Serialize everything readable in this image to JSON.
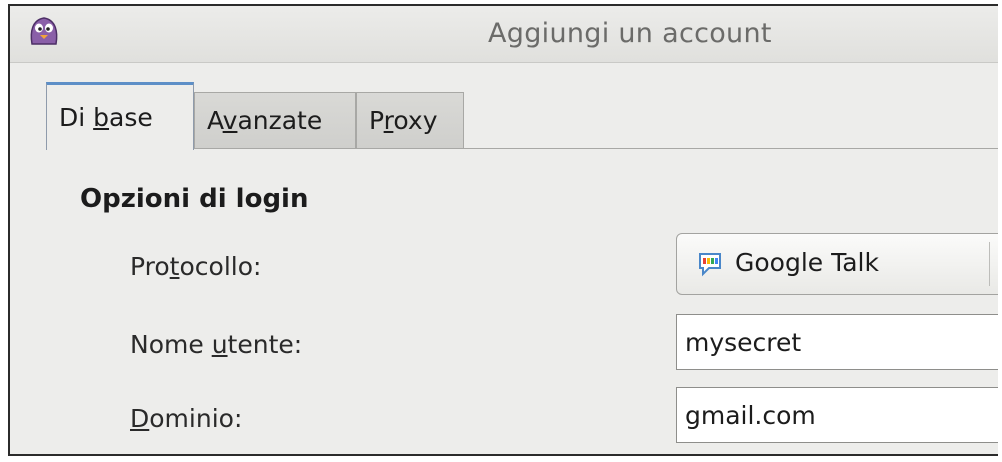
{
  "window": {
    "title": "Aggiungi un account",
    "app_icon": "pidgin-icon"
  },
  "tabs": [
    {
      "pre": "Di ",
      "mnemonic": "b",
      "post": "ase",
      "active": true
    },
    {
      "pre": "A",
      "mnemonic": "v",
      "post": "anzate",
      "active": false
    },
    {
      "pre": "P",
      "mnemonic": "r",
      "post": "oxy",
      "active": false
    }
  ],
  "section": {
    "title": "Opzioni di login"
  },
  "fields": {
    "protocol": {
      "label_pre": "Pro",
      "label_mnemonic": "t",
      "label_post": "ocollo:",
      "value": "Google Talk",
      "icon": "google-talk-icon"
    },
    "username": {
      "label_pre": "Nome ",
      "label_mnemonic": "u",
      "label_post": "tente:",
      "value": "mysecret"
    },
    "domain": {
      "label_pre": "",
      "label_mnemonic": "D",
      "label_post": "ominio:",
      "value": "gmail.com"
    }
  },
  "colors": {
    "active_tab_accent": "#5d8fc7",
    "window_bg": "#ededeb"
  }
}
